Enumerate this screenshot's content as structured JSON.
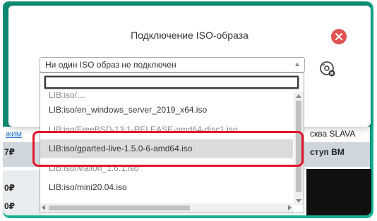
{
  "modal": {
    "title": "Подключение ISO-образа",
    "select_value": "Ни один ISO образ не подключен",
    "search_value": ""
  },
  "options": [
    "LIB:iso/en_windows_server_2019_x64.iso",
    "LIB:iso/FreeBSD-13.1-RELEASE-amd64-disc1.iso",
    "LIB:iso/gparted-live-1.5.0-6-amd64.iso",
    "LIB:iso/Mail0n_1.6.1.iso",
    "LIB:iso/mini20.04.iso"
  ],
  "selected_option_index": 2,
  "background": {
    "link_partial": "жим",
    "right_label": "сква SLAVA",
    "right_label_bold": "ступ ВМ",
    "left_prices": [
      "7₽",
      "0₽",
      "0₽"
    ]
  },
  "colors": {
    "close": "#e05353",
    "annotation": "#e3152b",
    "teal": "#16b394"
  },
  "icons": {
    "close": "close-icon",
    "disc": "disc-eject-icon"
  }
}
